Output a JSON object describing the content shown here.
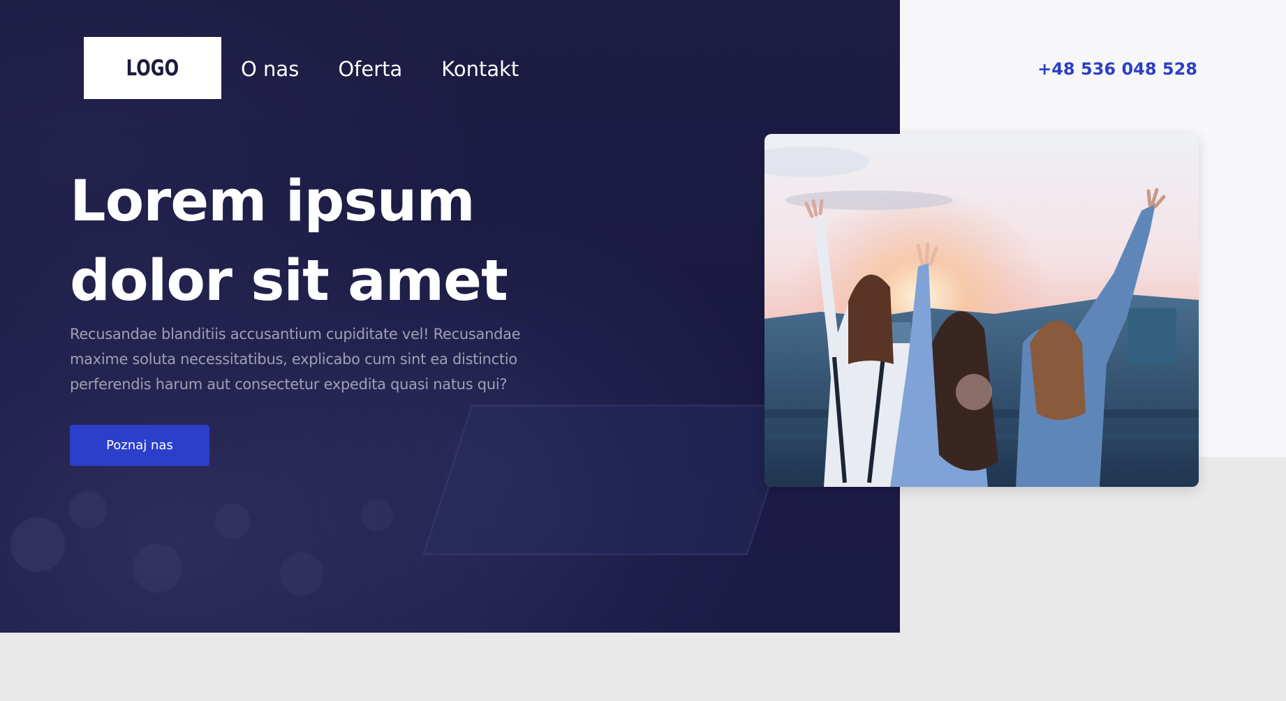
{
  "header": {
    "logo_text": "LOGO",
    "nav": [
      {
        "label": "O nas"
      },
      {
        "label": "Oferta"
      },
      {
        "label": "Kontakt"
      }
    ],
    "phone": "+48 536 048 528"
  },
  "hero": {
    "headline_line1": "Lorem ipsum",
    "headline_line2": "dolor sit amet",
    "lead": "Recusandae blanditiis accusantium cupiditate vel! Recusandae maxime soluta necessitatibus, explicabo cum sint ea distinctio perferendis harum aut consectetur expedita quasi natus qui?",
    "cta_label": "Poznaj nas"
  },
  "colors": {
    "hero_background": "#1c1b44",
    "accent": "#2c3fcb",
    "phone": "#2c3fc8",
    "right_panel": "#f7f7f9",
    "page_background": "#e9e9e9"
  }
}
